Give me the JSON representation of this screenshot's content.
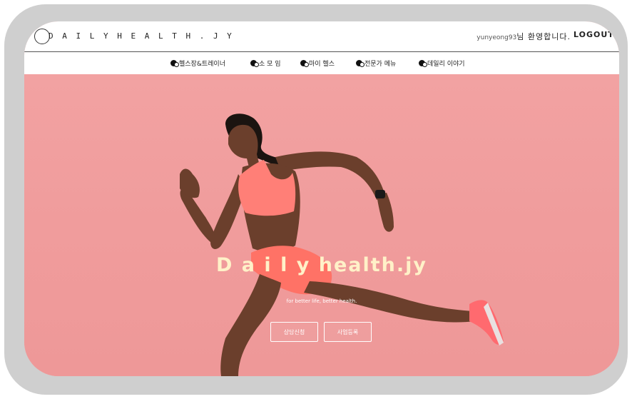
{
  "header": {
    "logo_text": "D A I L Y   H E A L T H . J Y",
    "username": "yunyeong93",
    "welcome_suffix": "님 환영합니다.",
    "logout_label": "LOGOUT"
  },
  "nav": {
    "items": [
      {
        "label": "헬스장&트레이너"
      },
      {
        "label": "소 모 임"
      },
      {
        "label": "마이 헬스"
      },
      {
        "label": "전문가 메뉴"
      },
      {
        "label": "데일리 이야기"
      }
    ]
  },
  "hero": {
    "title": "D a i l y health.jy",
    "subtitle": "for better life, better health.",
    "consult_button": "상담신청",
    "business_button": "사업등록"
  },
  "colors": {
    "hero_background": "#f09c9c",
    "title_color": "#fff1c8",
    "frame": "#cfcfcf"
  }
}
